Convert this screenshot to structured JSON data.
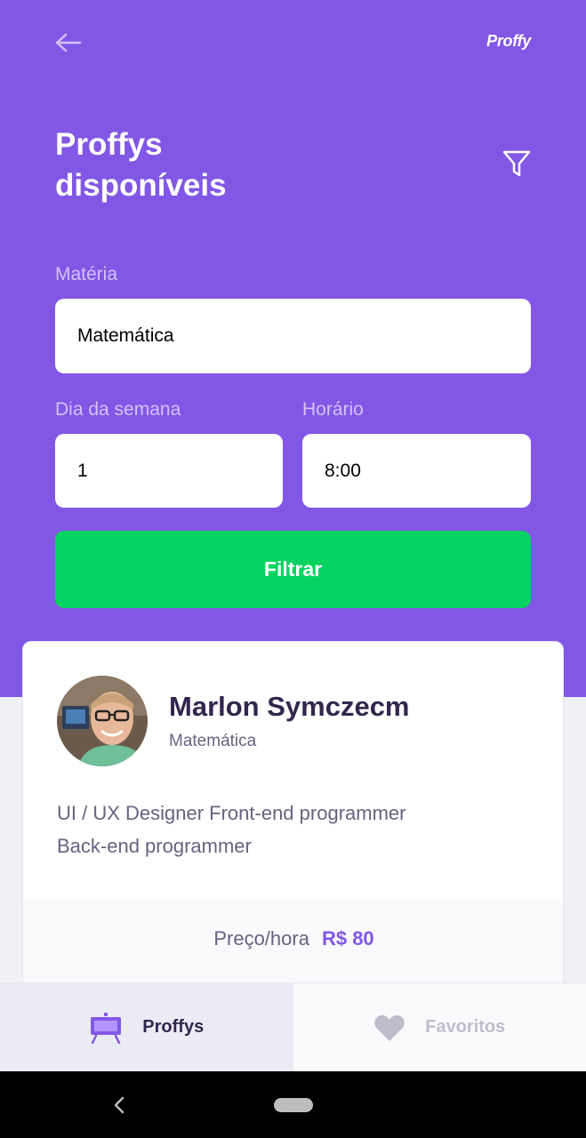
{
  "header": {
    "brand": "Proffy",
    "title": "Proffys disponíveis"
  },
  "form": {
    "subject_label": "Matéria",
    "subject_value": "Matemática",
    "week_day_label": "Dia da semana",
    "week_day_value": "1",
    "time_label": "Horário",
    "time_value": "8:00",
    "submit_label": "Filtrar"
  },
  "teacher": {
    "name": "Marlon Symczecm",
    "subject": "Matemática",
    "bio_line1": "UI / UX Designer Front-end programmer",
    "bio_line2": "Back-end programmer",
    "price_label": "Preço/hora",
    "price_value": "R$ 80"
  },
  "tabs": [
    {
      "label": "Proffys",
      "icon": "easel-icon",
      "active": true
    },
    {
      "label": "Favoritos",
      "icon": "heart-icon",
      "active": false
    }
  ],
  "colors": {
    "primary": "#8257E5",
    "secondary": "#04D361",
    "title_text": "#32264D",
    "body_text": "#6A6180"
  }
}
